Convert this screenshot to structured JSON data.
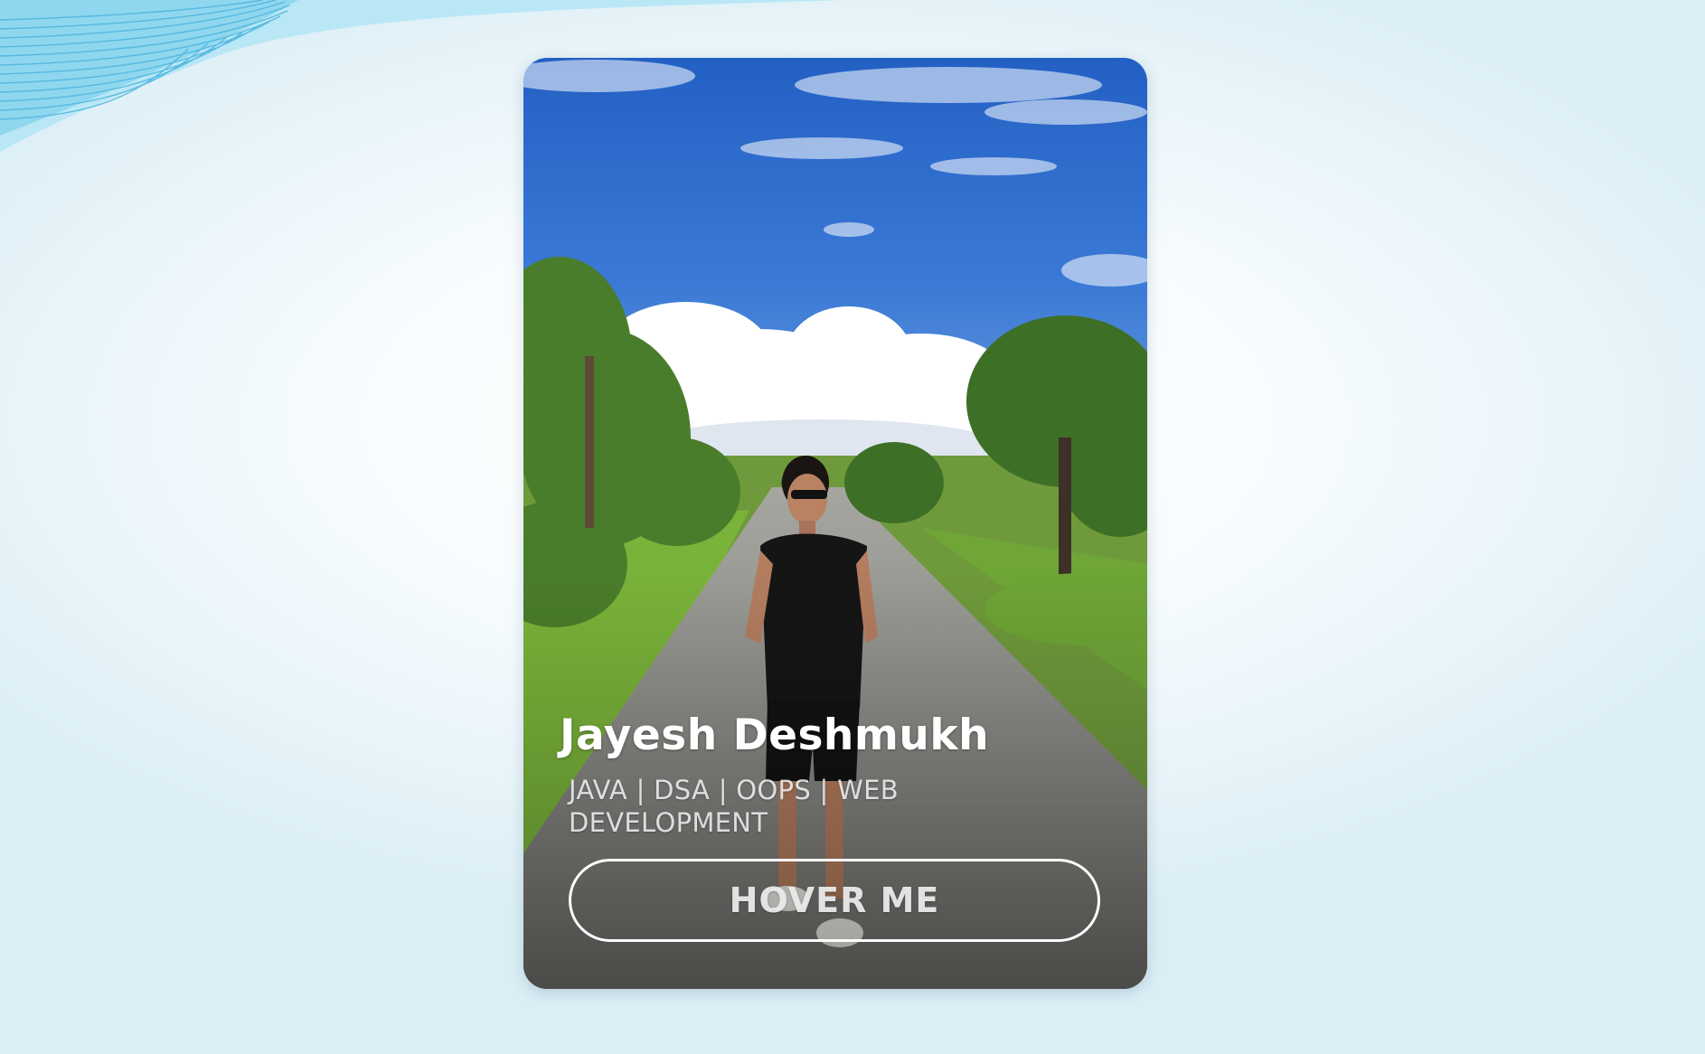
{
  "profile_card": {
    "name": "Jayesh Deshmukh",
    "tagline": "JAVA | DSA | OOPS | WEB DEVELOPMENT",
    "button_label": "HOVER ME"
  },
  "colors": {
    "sky": "#2f68c9",
    "wave": "#8fd7ef",
    "button_border": "#ffffff",
    "name_text": "#ffffff"
  }
}
